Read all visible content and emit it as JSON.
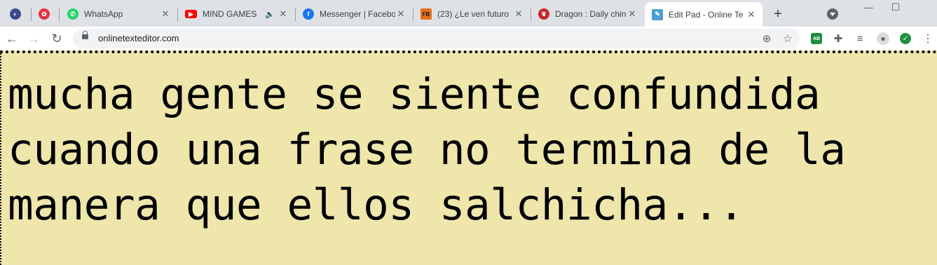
{
  "browser": {
    "pinned_tabs": [
      {
        "icon": "globe-icon",
        "color": "#3c4a8c"
      },
      {
        "icon": "red-gear-icon",
        "color": "#e8323c"
      }
    ],
    "tabs": [
      {
        "title": "WhatsApp",
        "icon": "whatsapp-icon",
        "color": "#25d366"
      },
      {
        "title": "MIND GAMES",
        "icon": "youtube-icon",
        "color": "#ff0000",
        "audio_icon": "🔈"
      },
      {
        "title": "Messenger | Facebo",
        "icon": "facebook-icon",
        "color": "#1877f2"
      },
      {
        "title": "(23) ¿Le ven futuro",
        "icon": "page-icon",
        "color": "#e8711c"
      },
      {
        "title": "Dragon : Daily chin",
        "icon": "dragon-icon",
        "color": "#c62828"
      },
      {
        "title": "Edit Pad - Online Te",
        "icon": "editpad-icon",
        "color": "#4a9fd4",
        "active": true
      }
    ],
    "new_tab_label": "+",
    "window_controls": {
      "minimize": "—",
      "maximize": "☐"
    },
    "url": "onlinetexteditor.com"
  },
  "editor": {
    "background": "#eee6aa",
    "lines": [
      "mucha gente se siente confundida",
      "cuando una frase no termina de la",
      "manera que ellos salchicha..."
    ]
  }
}
